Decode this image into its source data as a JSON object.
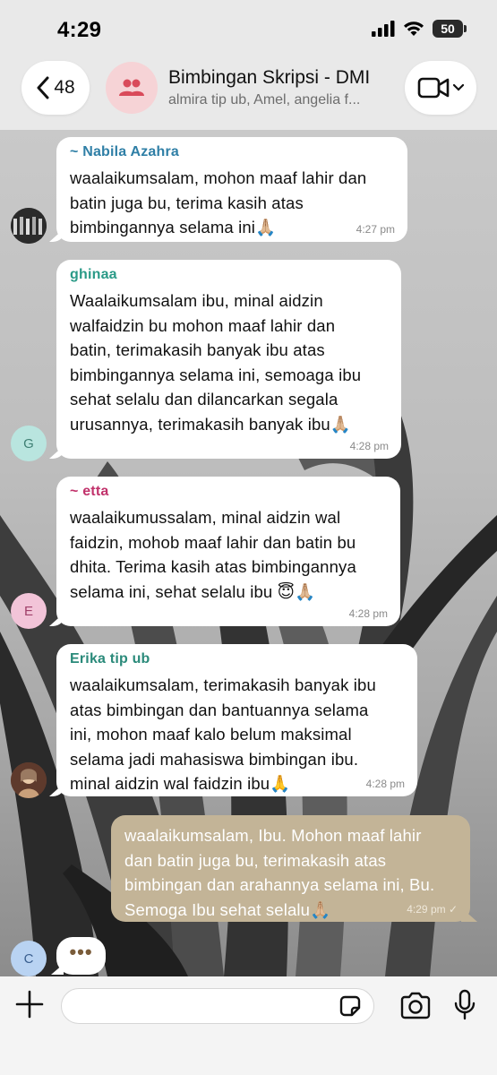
{
  "status_bar": {
    "time": "4:29",
    "battery": "50"
  },
  "header": {
    "back_count": "48",
    "title": "Bimbingan Skripsi - DMI",
    "members": "almira tip ub, Amel, angelia f..."
  },
  "messages": [
    {
      "sender": "~ Nabila Azahra",
      "sender_color": "#2f7fa6",
      "lines": [
        "waalaikumsalam, mohon maaf lahir dan",
        "batin juga bu, terima kasih atas",
        "bimbingannya selama ini🙏🏼"
      ],
      "time": "4:27 pm",
      "avatar": {
        "type": "photo",
        "label": ""
      }
    },
    {
      "sender": "ghinaa",
      "sender_color": "#2a9a87",
      "lines": [
        "Waalaikumsalam ibu, minal aidzin",
        "walfaidzin bu mohon maaf lahir dan",
        "batin, terimakasih banyak ibu atas",
        "bimbingannya selama ini, semoaga ibu",
        "sehat selalu dan dilancarkan segala",
        "urusannya, terimakasih banyak ibu🙏🏼"
      ],
      "time": "4:28 pm",
      "avatar": {
        "type": "letter",
        "label": "G",
        "bg": "#b9e5df"
      }
    },
    {
      "sender": "~ etta",
      "sender_color": "#c1326b",
      "lines": [
        "waalaikumussalam, minal aidzin wal",
        "faidzin, mohob maaf lahir dan batin bu",
        "dhita. Terima kasih atas bimbingannya",
        "selama ini, sehat selalu ibu 😇🙏🏼"
      ],
      "time": "4:28 pm",
      "avatar": {
        "type": "letter",
        "label": "E",
        "bg": "#f2c4d8"
      }
    },
    {
      "sender": "Erika tip ub",
      "sender_color": "#2a8a7a",
      "lines": [
        "waalaikumsalam, terimakasih banyak ibu",
        "atas bimbingan dan bantuannya selama",
        "ini, mohon maaf kalo belum maksimal",
        "selama jadi mahasiswa bimbingan ibu.",
        "minal aidzin wal faidzin ibu🙏"
      ],
      "time": "4:28 pm",
      "avatar": {
        "type": "photo",
        "label": ""
      }
    }
  ],
  "outgoing": {
    "lines": [
      "waalaikumsalam, Ibu. Mohon maaf lahir",
      "dan batin juga bu, terimakasih atas",
      "bimbingan dan arahannya selama ini, Bu.",
      "Semoga Ibu sehat selalu🙏🏼"
    ],
    "time": "4:29 pm ✓"
  },
  "typing": {
    "avatar_label": "C",
    "indicator": "•••"
  },
  "composer": {
    "placeholder": ""
  },
  "icons": {
    "back": "chevron-left-icon",
    "group": "people-icon",
    "video": "video-camera-icon",
    "plus": "plus-icon",
    "sticker": "sticker-icon",
    "camera": "camera-icon",
    "mic": "microphone-icon"
  }
}
